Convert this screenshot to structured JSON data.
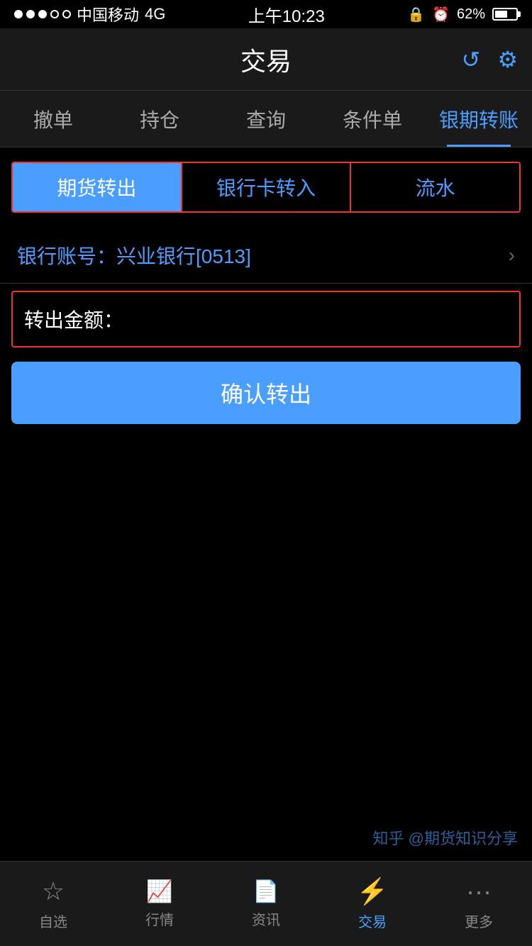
{
  "statusBar": {
    "carrier": "中国移动",
    "network": "4G",
    "time": "上午10:23",
    "battery": "62%"
  },
  "header": {
    "title": "交易",
    "refreshIcon": "↺",
    "settingsIcon": "⚙"
  },
  "navTabs": [
    {
      "id": "cancel",
      "label": "撤单",
      "active": false
    },
    {
      "id": "position",
      "label": "持仓",
      "active": false
    },
    {
      "id": "query",
      "label": "查询",
      "active": false
    },
    {
      "id": "condition",
      "label": "条件单",
      "active": false
    },
    {
      "id": "transfer",
      "label": "银期转账",
      "active": true
    }
  ],
  "subTabs": [
    {
      "id": "futures-out",
      "label": "期货转出",
      "active": true
    },
    {
      "id": "bank-in",
      "label": "银行卡转入",
      "active": false
    },
    {
      "id": "flow",
      "label": "流水",
      "active": false
    }
  ],
  "bankAccount": {
    "label": "银行账号：兴业银行",
    "highlight": "[0513]"
  },
  "amountField": {
    "label": "转出金额：",
    "placeholder": ""
  },
  "confirmButton": {
    "label": "确认转出"
  },
  "bottomNav": [
    {
      "id": "watchlist",
      "label": "自选",
      "icon": "☆",
      "active": false
    },
    {
      "id": "market",
      "label": "行情",
      "icon": "📈",
      "active": false
    },
    {
      "id": "news",
      "label": "资讯",
      "icon": "📄",
      "active": false
    },
    {
      "id": "trade",
      "label": "交易",
      "icon": "⚡",
      "active": true
    },
    {
      "id": "more",
      "label": "更多",
      "icon": "···",
      "active": false
    }
  ],
  "watermark": {
    "line1": "知乎 @期货知识分享",
    "line2": ""
  }
}
